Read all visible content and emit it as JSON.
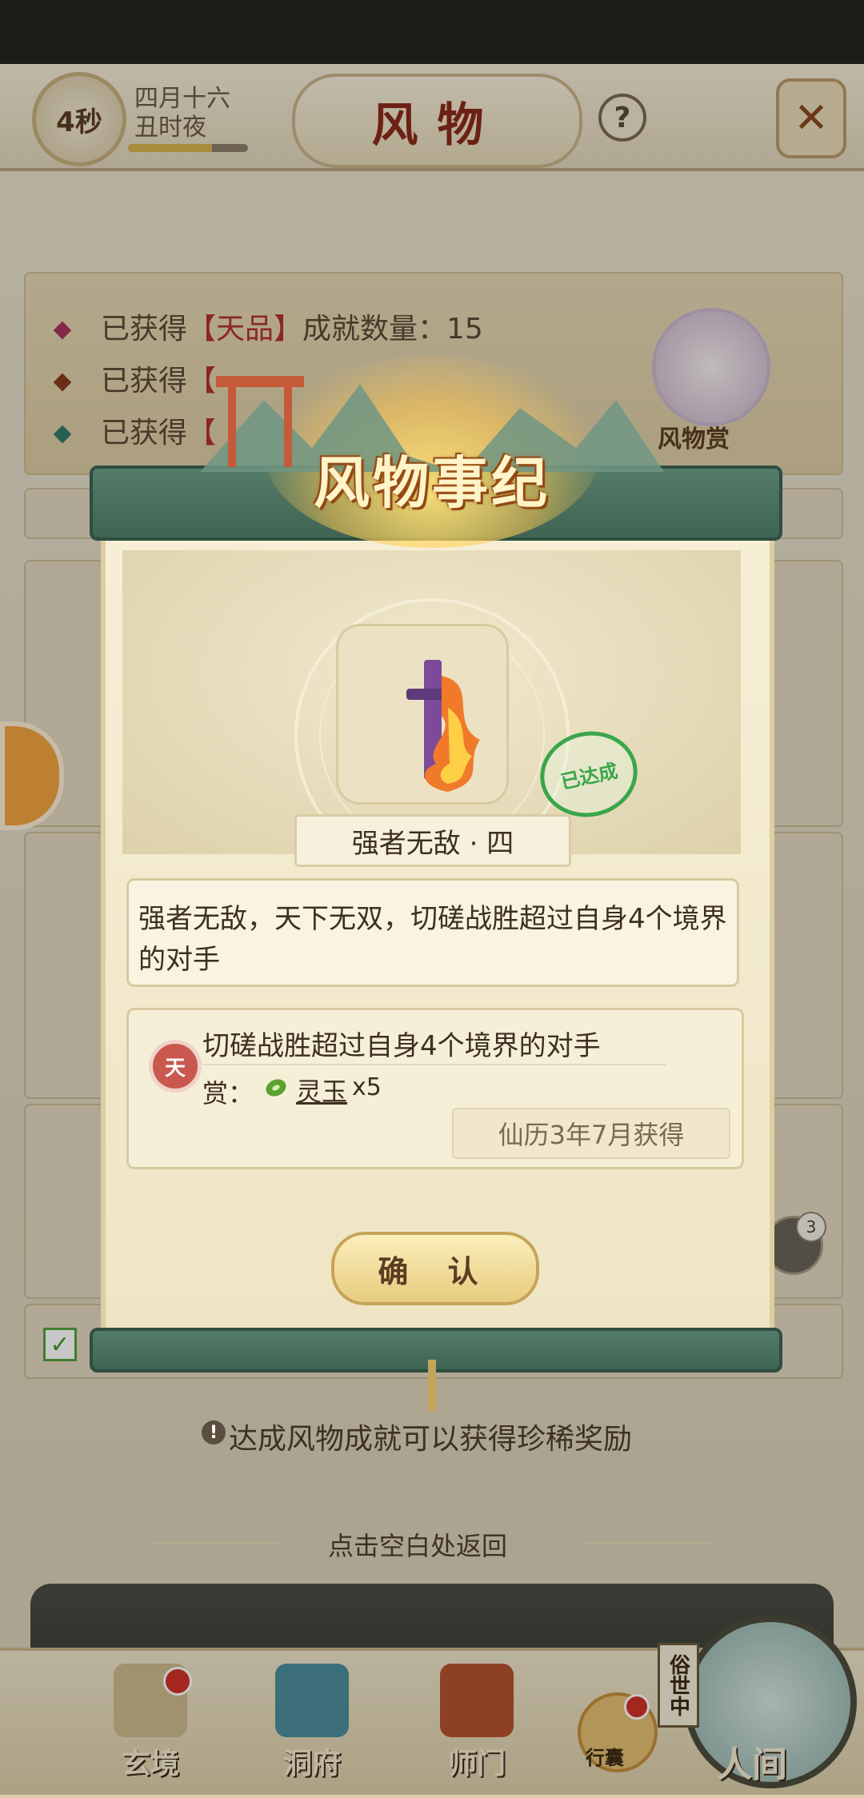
{
  "header": {
    "timer": "4秒",
    "date_line1": "四月十六",
    "date_line2": "丑时夜",
    "date_progress": 0.7,
    "title": "风物",
    "help_label": "?",
    "close_label": "✕"
  },
  "stats": {
    "rows": [
      {
        "prefix": "已获得",
        "tier": "【天品】",
        "suffix": "成就数量：15",
        "color": "#a8365a"
      },
      {
        "prefix": "已获得",
        "tier": "【",
        "suffix": "",
        "color": "#8b3a1e"
      },
      {
        "prefix": "已获得",
        "tier": "【",
        "suffix": "",
        "color": "#2f7a6a"
      }
    ],
    "avatar_label": "风物赏"
  },
  "modal": {
    "title": "风物事纪",
    "achievement_name": "强者无敌 · 四",
    "stamp": "已达成",
    "description": "强者无敌，天下无双，切磋战胜超过自身4个境界的对手",
    "tier_badge": "天",
    "condition": "切磋战胜超过自身4个境界的对手",
    "reward_label": "赏：",
    "reward_item": "灵玉",
    "reward_qty": "x5",
    "obtained_date": "仙历3年7月获得",
    "confirm_label": "确 认"
  },
  "hint": {
    "icon": "!",
    "text": "达成风物成就可以获得珍稀奖励"
  },
  "back_hint": "点击空白处返回",
  "chat_badge": "3",
  "bottom_nav": {
    "items": [
      {
        "label": "玄境",
        "emblem_color": "#cdbb8e"
      },
      {
        "label": "洞府",
        "emblem_color": "#4d8f9c"
      },
      {
        "label": "师门",
        "emblem_color": "#b5532f"
      }
    ],
    "pouch_label": "行囊",
    "world_tag": "俗世中",
    "world_label": "人间"
  },
  "colors": {
    "accent_red": "#8c2a1a",
    "scroll_green": "#3f6453",
    "stamp_green": "#3aa64a"
  }
}
